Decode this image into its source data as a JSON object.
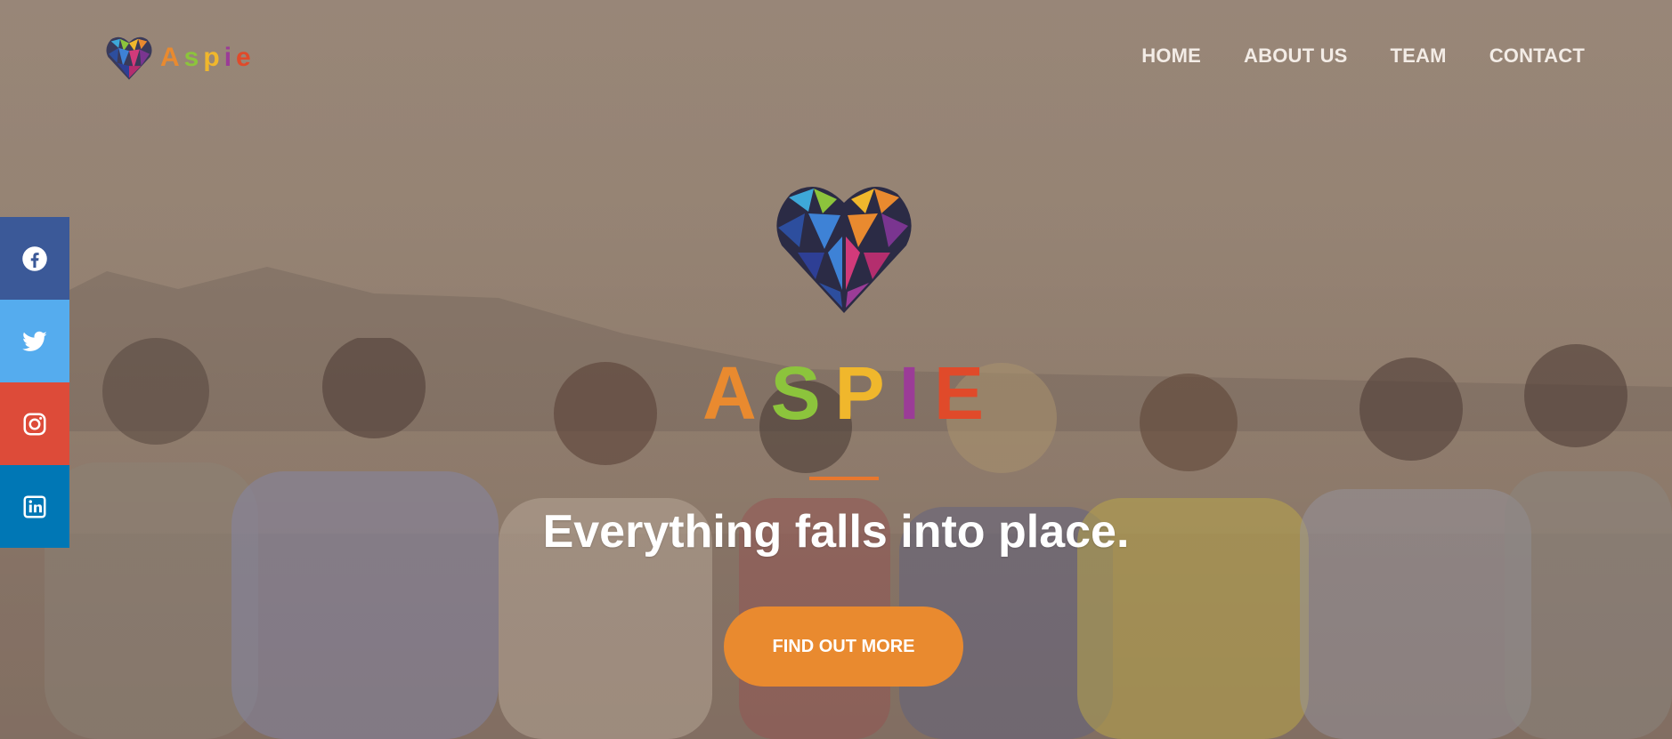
{
  "brand": {
    "letters": [
      {
        "char": "A",
        "color": "#e98a2f"
      },
      {
        "char": "s",
        "color": "#8cc43c"
      },
      {
        "char": "p",
        "color": "#f0b72c"
      },
      {
        "char": "i",
        "color": "#9b3c97"
      },
      {
        "char": "e",
        "color": "#e04a2a"
      }
    ],
    "logo_icon": "heart-mosaic-icon"
  },
  "nav": {
    "items": [
      {
        "label": "HOME"
      },
      {
        "label": "ABOUT US"
      },
      {
        "label": "TEAM"
      },
      {
        "label": "CONTACT"
      }
    ]
  },
  "social": [
    {
      "icon": "facebook-icon",
      "color": "#3b5998"
    },
    {
      "icon": "twitter-icon",
      "color": "#55acee"
    },
    {
      "icon": "instagram-icon",
      "color": "#dd4b39"
    },
    {
      "icon": "linkedin-icon",
      "color": "#0077b5"
    }
  ],
  "hero": {
    "title_letters": [
      {
        "char": "A",
        "color": "#e98a2f"
      },
      {
        "char": "S",
        "color": "#8cc43c"
      },
      {
        "char": "P",
        "color": "#f0b72c"
      },
      {
        "char": "I",
        "color": "#9b3c97"
      },
      {
        "char": "E",
        "color": "#e04a2a"
      }
    ],
    "divider_color": "#e8772e",
    "tagline": "Everything falls into place.",
    "cta_label": "FIND OUT MORE",
    "cta_color": "#e98a2f"
  }
}
